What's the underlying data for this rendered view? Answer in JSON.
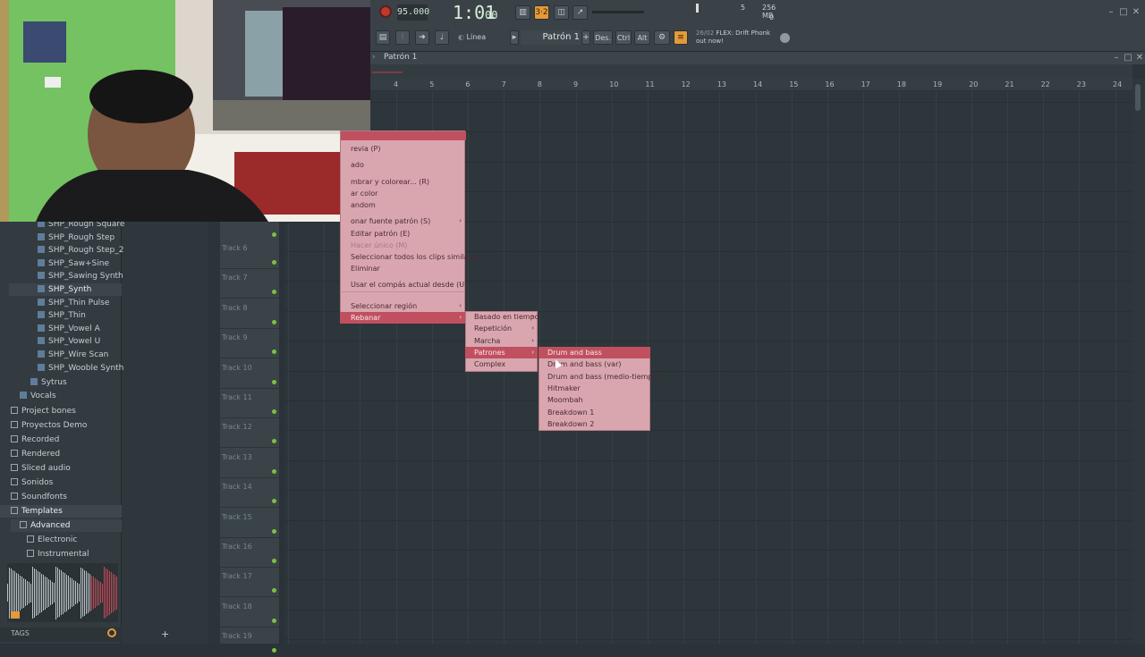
{
  "toolbar": {
    "tempo": "95.000",
    "time": "1:01",
    "time_sub": "00",
    "mode": "Línea",
    "pattern": "Patrón 1",
    "btn_des": "Des.",
    "btn_ctrl": "Ctrl",
    "btn_alt": "Alt",
    "cpu_num": "5",
    "mem": "256 MB",
    "poly": "0",
    "news_date": "26/02",
    "news_title": "FLEX: Drift Phonk",
    "news_sub": "out now!"
  },
  "playlist": {
    "title": "Patrón 1",
    "ruler": [
      "4",
      "5",
      "6",
      "7",
      "8",
      "9",
      "10",
      "11",
      "12",
      "13",
      "14",
      "15",
      "16",
      "17",
      "18",
      "19",
      "20",
      "21",
      "22",
      "23",
      "24"
    ],
    "tracks": [
      "Track 6",
      "Track 7",
      "Track 8",
      "Track 9",
      "Track 10",
      "Track 11",
      "Track 12",
      "Track 13",
      "Track 14",
      "Track 15",
      "Track 16",
      "Track 17",
      "Track 18",
      "Track 19"
    ]
  },
  "browser": {
    "presets": [
      "SHP_Rough Square",
      "SHP_Rough Step",
      "SHP_Rough Step_2",
      "SHP_Saw+Sine",
      "SHP_Sawing Synth",
      "SHP_Synth",
      "SHP_Thin Pulse",
      "SHP_Thin",
      "SHP_Vowel A",
      "SHP_Vowel U",
      "SHP_Wire Scan",
      "SHP_Wooble Synth"
    ],
    "sytrus": "Sytrus",
    "vocals": "Vocals",
    "folders": [
      "Project bones",
      "Proyectos Demo",
      "Recorded",
      "Rendered",
      "Sliced audio",
      "Sonidos",
      "Soundfonts",
      "Templates"
    ],
    "templates_sub": "Advanced",
    "advanced_sub": [
      "Electronic",
      "Instrumental"
    ],
    "tags_label": "TAGS"
  },
  "menu1": {
    "items": [
      "revia (P)",
      "ado",
      "mbrar y colorear... (R)",
      "ar color",
      "andom",
      "onar fuente patrón (S)",
      "Editar patrón (E)",
      "Hacer único (M)",
      "Seleccionar todos los clips similares",
      "Eliminar",
      "Usar el compás actual desde (U)",
      "Seleccionar región",
      "Rebanar"
    ]
  },
  "menu2": {
    "items": [
      "Basado en tiempo",
      "Repetición",
      "Marcha",
      "Patrones",
      "Complex"
    ]
  },
  "menu3": {
    "items": [
      "Drum and bass",
      "Drum and bass (var)",
      "Drum and bass (medio-tiempo)",
      "Hitmaker",
      "Moombah",
      "Breakdown 1",
      "Breakdown 2"
    ]
  }
}
